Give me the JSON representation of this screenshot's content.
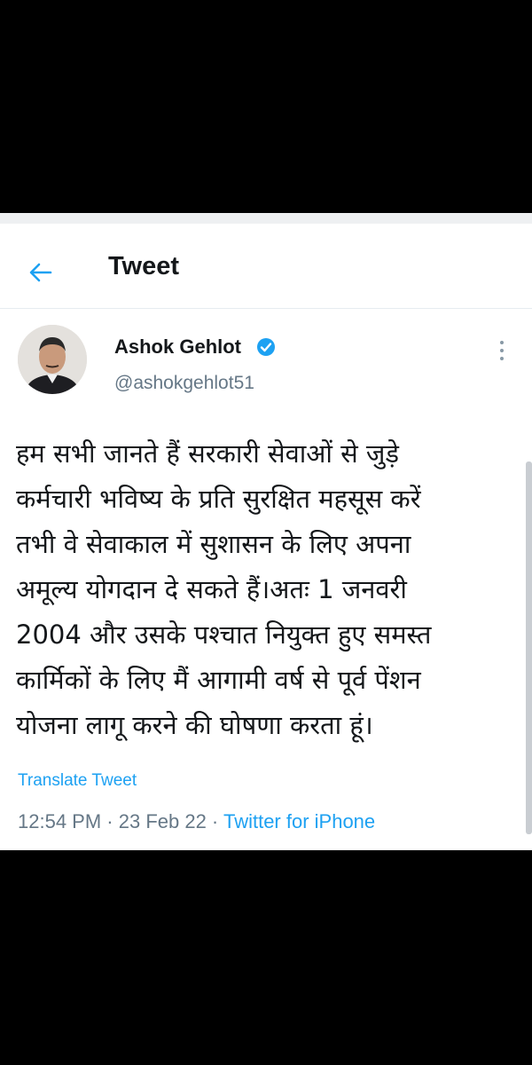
{
  "header": {
    "title": "Tweet"
  },
  "tweet": {
    "author_name": "Ashok Gehlot",
    "handle": "@ashokgehlot51",
    "lines": [
      "हम सभी जानते हैं सरकारी सेवाओं से जुड़े",
      "कर्मचारी भविष्य के प्रति सुरक्षित महसूस करें",
      "तभी वे सेवाकाल में सुशासन के लिए अपना",
      "अमूल्य योगदान दे सकते हैं।अतः 1 जनवरी",
      "2004 और उसके पश्चात नियुक्त हुए समस्त",
      "कार्मिकों के लिए मैं आगामी वर्ष से पूर्व पेंशन",
      "योजना लागू करने की घोषणा करता हूं।"
    ],
    "translate_label": "Translate Tweet",
    "time": "12:54 PM",
    "separator": " · ",
    "date": "23 Feb 22",
    "source": "Twitter for iPhone"
  },
  "colors": {
    "accent": "#1da1f2",
    "secondary_text": "#657786",
    "primary_text": "#14171a"
  },
  "icons": {
    "back": "arrow-left-icon",
    "verified": "verified-badge-icon",
    "more": "more-vertical-icon"
  }
}
